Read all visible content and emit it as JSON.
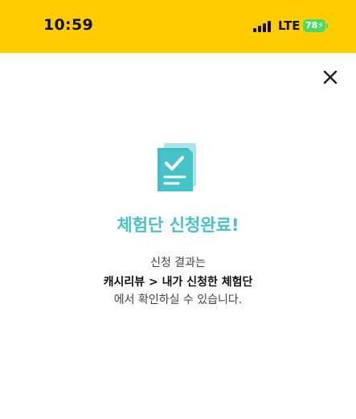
{
  "status_bar": {
    "time": "10:59",
    "network": "LTE",
    "battery_level": "78",
    "battery_color": "#4CD964",
    "bar_color": "#FFCC00"
  },
  "dialog": {
    "close_icon": "close-icon",
    "doc_icon": "document-check-icon",
    "accent_color": "#45C3C8",
    "title": "체험단 신청완료!",
    "message_line1": "신청 결과는",
    "message_line2": "캐시리뷰 > 내가 신청한 체험단",
    "message_line3": "에서 확인하실 수 있습니다."
  }
}
